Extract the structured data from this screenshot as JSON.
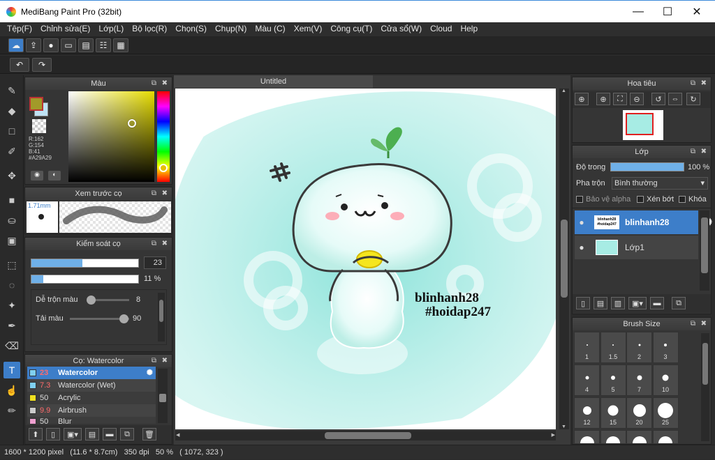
{
  "window": {
    "title": "MediBang Paint Pro (32bit)",
    "minimize": "—",
    "maximize": "☐",
    "close": "✕"
  },
  "menu": [
    "Tệp(F)",
    "Chỉnh sửa(E)",
    "Lớp(L)",
    "Bộ lọc(R)",
    "Chọn(S)",
    "Chụp(N)",
    "Màu (C)",
    "Xem(V)",
    "Công cụ(T)",
    "Cửa sổ(W)",
    "Cloud",
    "Help"
  ],
  "color_panel": {
    "title": "Màu",
    "r": "R:162",
    "g": "G:154",
    "b": "B:41",
    "hex": "#A29A29",
    "fg": "#a29a29",
    "bg": "#bfe3f5"
  },
  "brush_preview": {
    "title": "Xem trước cọ",
    "size": "1.71mm"
  },
  "brush_control": {
    "title": "Kiểm soát cọ",
    "size_value": "23",
    "size_fraction": 0.48,
    "opacity_value": "11 %",
    "opacity_fraction": 0.11,
    "blend_label": "Dễ trộn màu",
    "blend_value": "8",
    "blend_fraction": 0.08,
    "amount_label": "Tải màu",
    "amount_value": "90",
    "amount_fraction": 0.9
  },
  "brush_list": {
    "title": "Cọ: Watercolor",
    "items": [
      {
        "size": "23",
        "name": "Watercolor",
        "color": "#7fd0f0",
        "size_color": "#ff6b6b"
      },
      {
        "size": "7.3",
        "name": "Watercolor (Wet)",
        "color": "#7fd0f0",
        "size_color": "#ff6b6b"
      },
      {
        "size": "50",
        "name": "Acrylic",
        "color": "#f0e020",
        "size_color": "#dddddd"
      },
      {
        "size": "9.9",
        "name": "Airbrush",
        "color": "#cccccc",
        "size_color": "#ff6b6b"
      },
      {
        "size": "50",
        "name": "Blur",
        "color": "#f0a0d0",
        "size_color": "#dddddd"
      }
    ]
  },
  "canvas": {
    "tab": "Untitled",
    "text_line1": "blinhanh28",
    "text_line2": "#hoidap247"
  },
  "navigator": {
    "title": "Hoa tiêu"
  },
  "layer_panel": {
    "title": "Lớp",
    "opacity_label": "Độ trong",
    "opacity_value": "100 %",
    "opacity_fraction": 1.0,
    "blend_label": "Pha trộn",
    "blend_value": "Bình thường",
    "protect_alpha": "Bảo vệ alpha",
    "clipping": "Xén bớt",
    "lock": "Khóa",
    "layers": [
      {
        "name": "blinhanh28",
        "thumb_text": "blinhanh28 #hoidap247"
      },
      {
        "name": "Lớp1"
      }
    ]
  },
  "brush_size": {
    "title": "Brush Size",
    "sizes": [
      "1",
      "1.5",
      "2",
      "3",
      "4",
      "5",
      "7",
      "10",
      "12",
      "15",
      "20",
      "25",
      "",
      "",
      "",
      ""
    ]
  },
  "status": {
    "pixel": "1600 * 1200 pixel",
    "cm": "(11.6 * 8.7cm)",
    "dpi": "350 dpi",
    "zoom": "50 %",
    "coords": "( 1072, 323 )"
  }
}
